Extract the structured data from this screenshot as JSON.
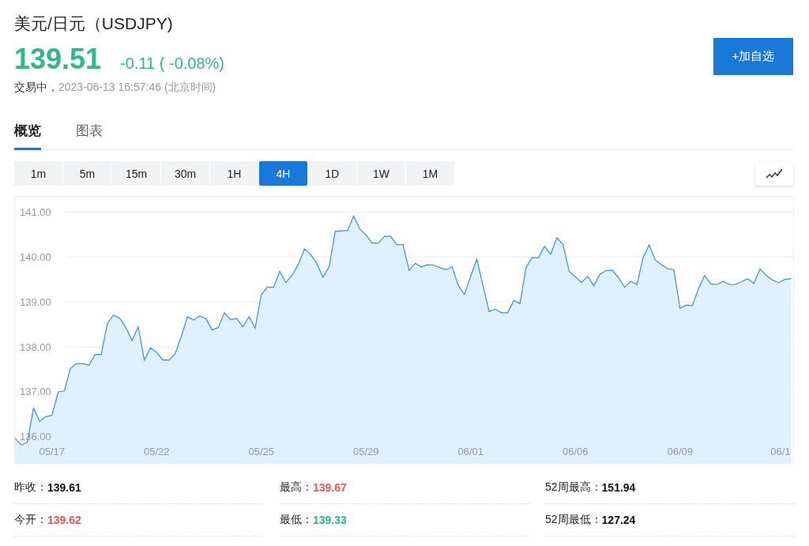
{
  "header": {
    "title": "美元/日元（USDJPY)",
    "price": "139.51",
    "change": "-0.11 ( -0.08%)",
    "color": "#2fb98b",
    "status": "交易中，",
    "timestamp": "2023-06-13 16:57:46 (北京时间)",
    "watch_button": "+加自选"
  },
  "tabs": [
    {
      "label": "概览",
      "selected": true
    },
    {
      "label": "图表",
      "selected": false
    }
  ],
  "periods": [
    {
      "label": "1m",
      "selected": false
    },
    {
      "label": "5m",
      "selected": false
    },
    {
      "label": "15m",
      "selected": false
    },
    {
      "label": "30m",
      "selected": false
    },
    {
      "label": "1H",
      "selected": false
    },
    {
      "label": "4H",
      "selected": true
    },
    {
      "label": "1D",
      "selected": false
    },
    {
      "label": "1W",
      "selected": false
    },
    {
      "label": "1M",
      "selected": false
    }
  ],
  "chart_data": {
    "type": "area",
    "grid": true,
    "ylim": [
      135.4,
      141.34
    ],
    "categories": [
      null,
      null,
      null,
      null,
      null,
      null,
      "05/17",
      null,
      null,
      null,
      null,
      null,
      null,
      null,
      null,
      null,
      null,
      null,
      null,
      null,
      null,
      null,
      null,
      "05/22",
      null,
      null,
      null,
      null,
      null,
      null,
      null,
      null,
      null,
      null,
      null,
      null,
      null,
      null,
      null,
      null,
      "05/25",
      null,
      null,
      null,
      null,
      null,
      null,
      null,
      null,
      null,
      null,
      null,
      null,
      null,
      null,
      null,
      null,
      "05/29",
      null,
      null,
      null,
      null,
      null,
      null,
      null,
      null,
      null,
      null,
      null,
      null,
      null,
      null,
      null,
      null,
      "06/01",
      null,
      null,
      null,
      null,
      null,
      null,
      null,
      null,
      null,
      null,
      null,
      null,
      null,
      null,
      null,
      null,
      "06/06",
      null,
      null,
      null,
      null,
      null,
      null,
      null,
      null,
      null,
      null,
      null,
      null,
      null,
      null,
      null,
      null,
      "06/09",
      null,
      null,
      null,
      null,
      null,
      null,
      null,
      null,
      null,
      null,
      null,
      null,
      null,
      null,
      null,
      null,
      "06/1",
      null
    ],
    "yticks": [
      {
        "value": 136,
        "label": "136.00"
      },
      {
        "value": 137,
        "label": "137.00"
      },
      {
        "value": 138,
        "label": "138.00"
      },
      {
        "value": 139,
        "label": "139.00"
      },
      {
        "value": 140,
        "label": "140.00"
      },
      {
        "value": 141,
        "label": "141.00"
      }
    ],
    "series": [
      {
        "color": "#3a8ee6",
        "values": [
          135.97,
          135.82,
          135.88,
          136.64,
          136.35,
          136.45,
          136.48,
          137.0,
          137.02,
          137.52,
          137.63,
          137.63,
          137.59,
          137.83,
          137.83,
          138.52,
          138.71,
          138.64,
          138.43,
          138.14,
          138.45,
          137.71,
          137.98,
          137.88,
          137.71,
          137.71,
          137.85,
          138.23,
          138.67,
          138.6,
          138.69,
          138.63,
          138.38,
          138.43,
          138.76,
          138.61,
          138.63,
          138.45,
          138.67,
          138.42,
          139.16,
          139.33,
          139.33,
          139.68,
          139.43,
          139.6,
          139.83,
          140.18,
          140.06,
          139.86,
          139.55,
          139.78,
          140.57,
          140.58,
          140.59,
          140.91,
          140.62,
          140.49,
          140.31,
          140.31,
          140.46,
          140.46,
          140.27,
          140.28,
          139.7,
          139.86,
          139.78,
          139.83,
          139.82,
          139.76,
          139.72,
          139.78,
          139.36,
          139.17,
          139.57,
          139.95,
          139.37,
          138.79,
          138.84,
          138.76,
          138.76,
          139.03,
          138.96,
          139.77,
          139.99,
          139.98,
          140.24,
          140.06,
          140.43,
          140.28,
          139.68,
          139.56,
          139.43,
          139.57,
          139.36,
          139.62,
          139.7,
          139.71,
          139.54,
          139.33,
          139.46,
          139.39,
          139.99,
          140.27,
          139.93,
          139.83,
          139.74,
          139.72,
          138.86,
          138.93,
          138.92,
          139.29,
          139.59,
          139.4,
          139.39,
          139.46,
          139.39,
          139.39,
          139.45,
          139.52,
          139.41,
          139.74,
          139.59,
          139.49,
          139.43,
          139.5,
          139.52
        ]
      }
    ]
  },
  "stats": [
    {
      "label": "昨收：",
      "value": "139.61",
      "color": "#111111"
    },
    {
      "label": "最高：",
      "value": "139.67",
      "color": "#f25555"
    },
    {
      "label": "52周最高：",
      "value": "151.94",
      "color": "#111111"
    },
    {
      "label": "今开：",
      "value": "139.62",
      "color": "#f25555"
    },
    {
      "label": "最低：",
      "value": "139.33",
      "color": "#2fb98b"
    },
    {
      "label": "52周最低：",
      "value": "127.24",
      "color": "#111111"
    }
  ]
}
